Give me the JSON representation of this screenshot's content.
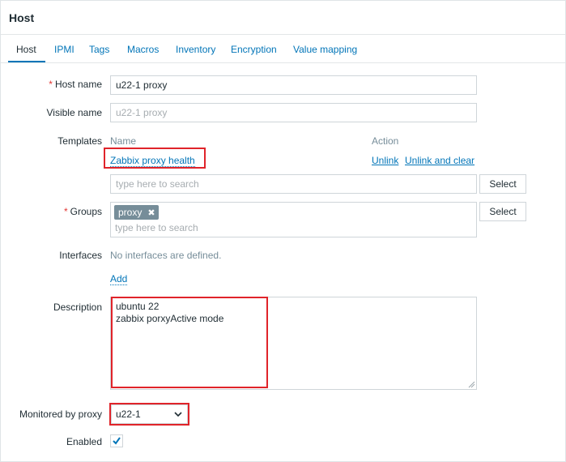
{
  "page": {
    "title": "Host"
  },
  "tabs": [
    {
      "label": "Host",
      "active": true
    },
    {
      "label": "IPMI"
    },
    {
      "label": "Tags"
    },
    {
      "label": "Macros"
    },
    {
      "label": "Inventory"
    },
    {
      "label": "Encryption"
    },
    {
      "label": "Value mapping"
    }
  ],
  "form": {
    "host_name": {
      "label": "Host name",
      "required_mark": "*",
      "value": "u22-1 proxy"
    },
    "visible_name": {
      "label": "Visible name",
      "placeholder": "u22-1 proxy"
    },
    "templates": {
      "label": "Templates",
      "col_name": "Name",
      "col_action": "Action",
      "items": [
        {
          "name": "Zabbix proxy health",
          "unlink": "Unlink",
          "unlink_clear": "Unlink and clear"
        }
      ],
      "search_placeholder": "type here to search",
      "select_label": "Select"
    },
    "groups": {
      "label": "Groups",
      "required_mark": "*",
      "chips": [
        "proxy"
      ],
      "chip_remove": "✖",
      "search_placeholder": "type here to search",
      "select_label": "Select"
    },
    "interfaces": {
      "label": "Interfaces",
      "empty_text": "No interfaces are defined.",
      "add_label": "Add"
    },
    "description": {
      "label": "Description",
      "value": "ubuntu 22\nzabbix porxyActive mode"
    },
    "monitored_by_proxy": {
      "label": "Monitored by proxy",
      "value": "u22-1"
    },
    "enabled": {
      "label": "Enabled",
      "checked": true
    }
  },
  "colors": {
    "accent": "#0275b8",
    "highlight_box": "#e0242a",
    "required": "#e33734"
  }
}
